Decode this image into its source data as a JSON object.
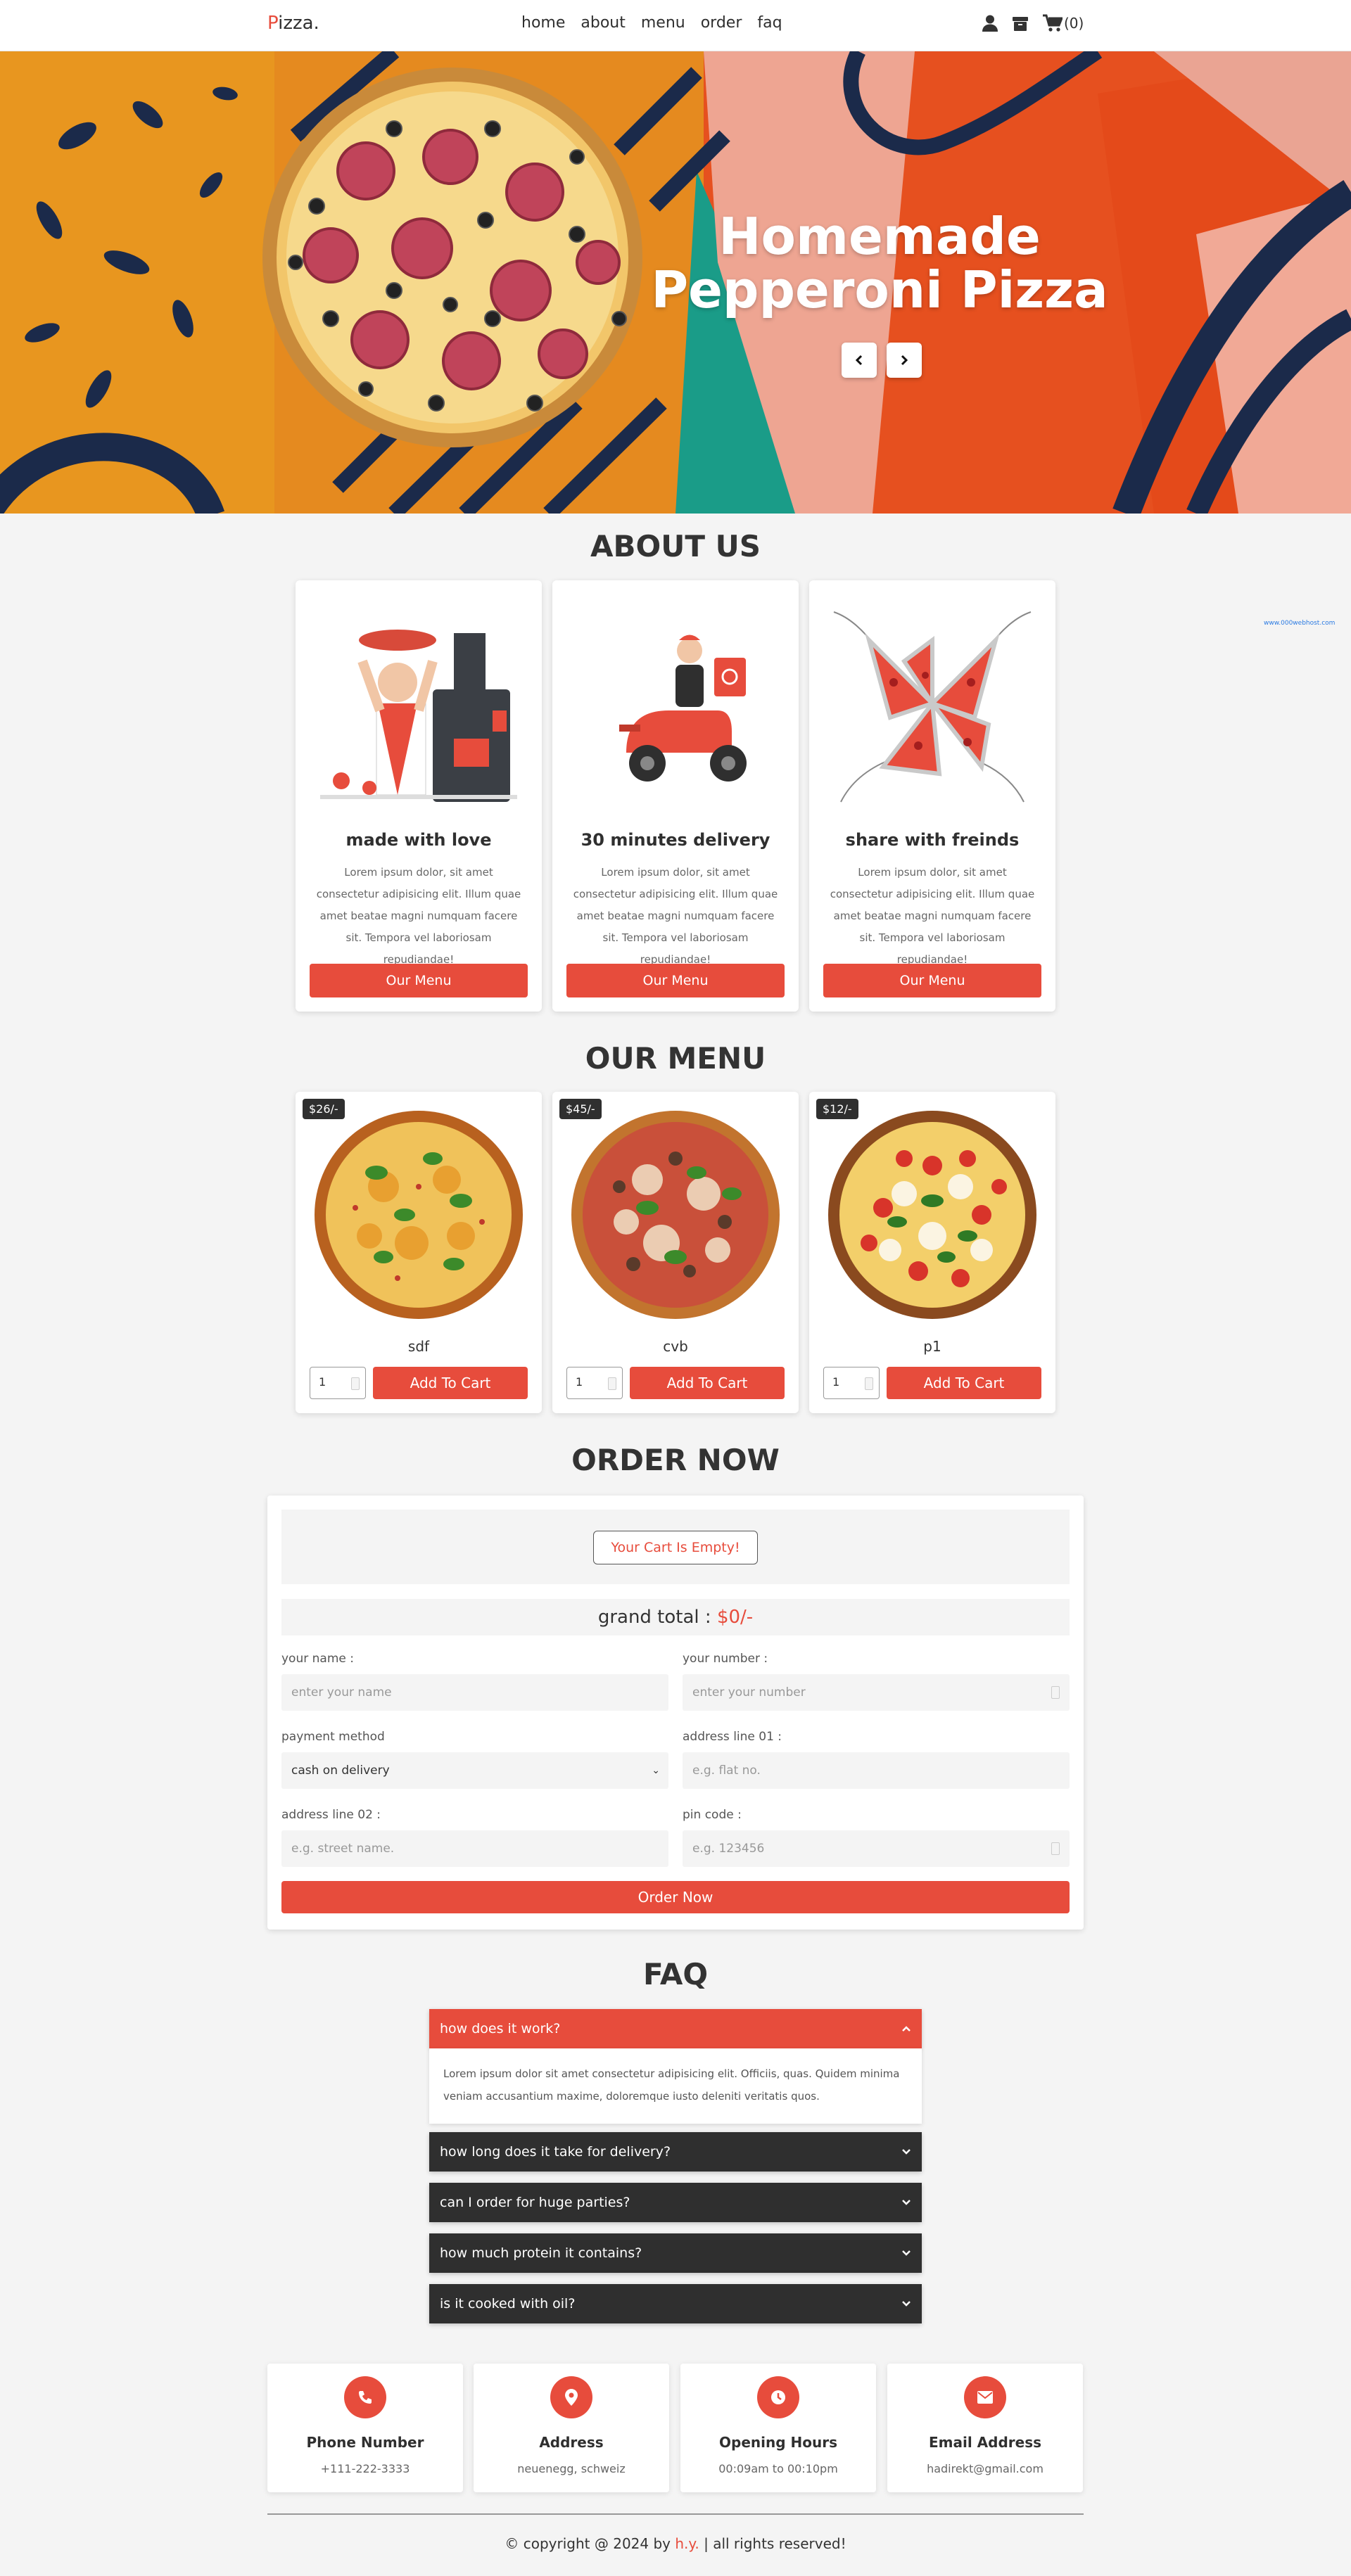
{
  "header": {
    "logo_first": "P",
    "logo_rest": "izza.",
    "nav": [
      "home",
      "about",
      "menu",
      "order",
      "faq"
    ],
    "cart_count": "(0)",
    "icons": [
      "user-icon",
      "box-icon",
      "cart-icon"
    ]
  },
  "hero": {
    "title_line1": "Homemade",
    "title_line2": "Pepperoni Pizza"
  },
  "about": {
    "title": "ABOUT US",
    "cards": [
      {
        "title": "made with love",
        "text": "Lorem ipsum dolor, sit amet consectetur adipisicing elit. Illum quae amet beatae magni numquam facere sit. Tempora vel laboriosam repudiandae!",
        "button": "Our Menu"
      },
      {
        "title": "30 minutes delivery",
        "text": "Lorem ipsum dolor, sit amet consectetur adipisicing elit. Illum quae amet beatae magni numquam facere sit. Tempora vel laboriosam repudiandae!",
        "button": "Our Menu"
      },
      {
        "title": "share with freinds",
        "text": "Lorem ipsum dolor, sit amet consectetur adipisicing elit. Illum quae amet beatae magni numquam facere sit. Tempora vel laboriosam repudiandae!",
        "button": "Our Menu"
      }
    ]
  },
  "menu": {
    "title": "OUR MENU",
    "items": [
      {
        "price": "$26/-",
        "name": "sdf",
        "qty": "1",
        "button": "Add To Cart"
      },
      {
        "price": "$45/-",
        "name": "cvb",
        "qty": "1",
        "button": "Add To Cart"
      },
      {
        "price": "$12/-",
        "name": "p1",
        "qty": "1",
        "button": "Add To Cart"
      }
    ]
  },
  "order": {
    "title": "ORDER NOW",
    "empty_cart": "Your Cart Is Empty!",
    "grand_label": "grand total :",
    "grand_value": "$0/-",
    "fields": {
      "name_label": "your name :",
      "name_placeholder": "enter your name",
      "number_label": "your number :",
      "number_placeholder": "enter your number",
      "payment_label": "payment method",
      "payment_value": "cash on delivery",
      "addr1_label": "address line 01 :",
      "addr1_placeholder": "e.g. flat no.",
      "addr2_label": "address line 02 :",
      "addr2_placeholder": "e.g. street name.",
      "pin_label": "pin code :",
      "pin_placeholder": "e.g. 123456"
    },
    "submit": "Order Now"
  },
  "faq": {
    "title": "FAQ",
    "items": [
      {
        "q": "how does it work?",
        "open": true
      },
      {
        "q": "how long does it take for delivery?"
      },
      {
        "q": "can I order for huge parties?"
      },
      {
        "q": "how much protein it contains?"
      },
      {
        "q": "is it cooked with oil?"
      }
    ],
    "answer": "Lorem ipsum dolor sit amet consectetur adipisicing elit. Officiis, quas. Quidem minima veniam accusantium maxime, doloremque iusto deleniti veritatis quos."
  },
  "info": [
    {
      "title": "Phone Number",
      "value": "+111-222-3333",
      "icon": "phone-icon"
    },
    {
      "title": "Address",
      "value": "neuenegg, schweiz",
      "icon": "map-pin-icon"
    },
    {
      "title": "Opening Hours",
      "value": "00:09am to 00:10pm",
      "icon": "clock-icon"
    },
    {
      "title": "Email Address",
      "value": "hadirekt@gmail.com",
      "icon": "envelope-icon"
    }
  ],
  "footer": {
    "copy_pre": "© copyright @ 2024 by",
    "copy_name": "h.y.",
    "copy_post": "| all rights reserved!"
  },
  "watermark": "www.000webhost.com",
  "colors": {
    "accent": "#e74c3c",
    "dark": "#2f2f2f",
    "background": "#f4f4f4"
  }
}
